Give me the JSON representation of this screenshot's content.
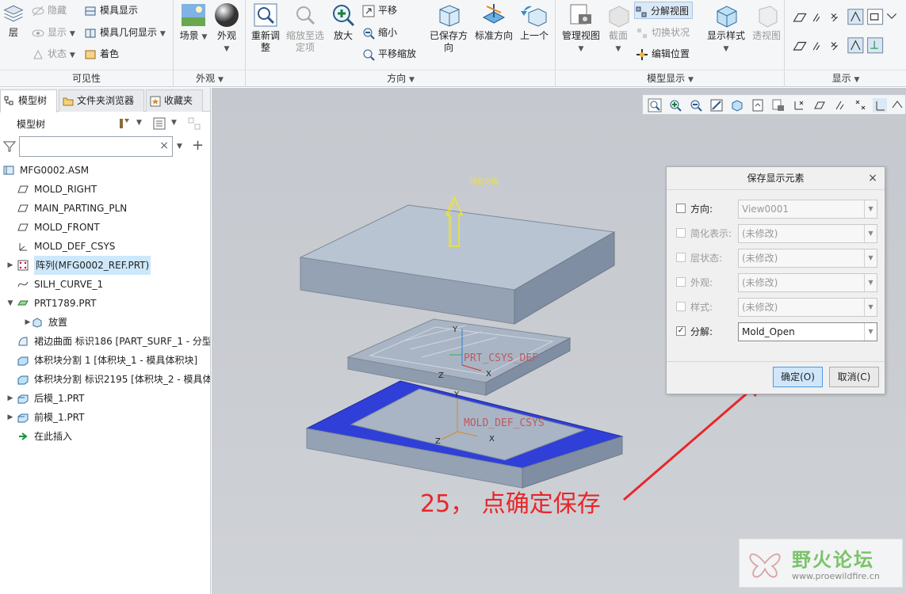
{
  "ribbon": {
    "visibility": {
      "title": "可见性",
      "layer": "层",
      "hide": "隐藏",
      "show": "显示",
      "status": "状态",
      "mold_display": "模具显示",
      "mold_geom_display": "模具几何显示",
      "color": "着色"
    },
    "appearance": {
      "title": "外观",
      "scene": "场景",
      "appearance": "外观"
    },
    "orientation": {
      "title": "方向",
      "refit": "重新调整",
      "zoom_to_selected": "缩放至选定项",
      "zoom_in": "放大",
      "pan": "平移",
      "zoom_out": "缩小",
      "pan_zoom": "平移缩放",
      "saved_orientation": "已保存方向",
      "standard_orientation": "标准方向",
      "previous": "上一个"
    },
    "model_display": {
      "title": "模型显示",
      "manage_views": "管理视图",
      "section": "截面",
      "explode_view": "分解视图",
      "toggle_status": "切换状况",
      "edit_position": "编辑位置"
    },
    "show": {
      "title": "显示",
      "display_style": "显示样式",
      "perspective": "透视图"
    }
  },
  "left_panel": {
    "tabs": [
      "模型树",
      "文件夹浏览器",
      "收藏夹"
    ],
    "tree_header": "模型树",
    "filter_placeholder": "",
    "tree_items": [
      {
        "text": "MFG0002.ASM",
        "level": 0,
        "icon": "assembly-icon",
        "expand": ""
      },
      {
        "text": "MOLD_RIGHT",
        "level": 1,
        "icon": "datum-plane-icon",
        "expand": ""
      },
      {
        "text": "MAIN_PARTING_PLN",
        "level": 1,
        "icon": "datum-plane-icon",
        "expand": ""
      },
      {
        "text": "MOLD_FRONT",
        "level": 1,
        "icon": "datum-plane-icon",
        "expand": ""
      },
      {
        "text": "MOLD_DEF_CSYS",
        "level": 1,
        "icon": "csys-icon",
        "expand": ""
      },
      {
        "text": "阵列(MFG0002_REF.PRT)",
        "level": 1,
        "icon": "pattern-icon",
        "expand": "▶",
        "selected": true
      },
      {
        "text": "SILH_CURVE_1",
        "level": 1,
        "icon": "curve-icon",
        "expand": ""
      },
      {
        "text": "PRT1789.PRT",
        "level": 1,
        "icon": "part-icon",
        "expand": "▼"
      },
      {
        "text": "放置",
        "level": 2,
        "icon": "placement-icon",
        "expand": "▶"
      },
      {
        "text": "裙边曲面 标识186 [PART_SURF_1 - 分型",
        "level": 1,
        "icon": "surface-icon",
        "expand": ""
      },
      {
        "text": "体积块分割 1 [体积块_1 - 模具体积块]",
        "level": 1,
        "icon": "volume-split-icon",
        "expand": ""
      },
      {
        "text": "体积块分割 标识2195 [体积块_2 - 模具体",
        "level": 1,
        "icon": "volume-split-icon",
        "expand": ""
      },
      {
        "text": "后模_1.PRT",
        "level": 1,
        "icon": "mold-part-icon",
        "expand": "▶"
      },
      {
        "text": "前模_1.PRT",
        "level": 1,
        "icon": "mold-part-icon",
        "expand": "▶"
      },
      {
        "text": "在此插入",
        "level": 1,
        "icon": "insert-here-icon",
        "expand": ""
      }
    ]
  },
  "viewport": {
    "pull_direction_label": "拖拉方向",
    "csys_label_1": "PRT_CSYS_DEF",
    "csys_label_2": "MOLD_DEF_CSYS",
    "axis_x": "X",
    "axis_y": "Y",
    "axis_z": "Z"
  },
  "dialog": {
    "title": "保存显示元素",
    "rows": [
      {
        "label": "方向:",
        "value": "View0001",
        "checked": false,
        "enabled": true
      },
      {
        "label": "简化表示:",
        "value": "(未修改)",
        "checked": false,
        "enabled": false
      },
      {
        "label": "层状态:",
        "value": "(未修改)",
        "checked": false,
        "enabled": false
      },
      {
        "label": "外观:",
        "value": "(未修改)",
        "checked": false,
        "enabled": false
      },
      {
        "label": "样式:",
        "value": "(未修改)",
        "checked": false,
        "enabled": false
      },
      {
        "label": "分解:",
        "value": "Mold_Open",
        "checked": true,
        "enabled": true
      }
    ],
    "ok_label": "确定(O)",
    "cancel_label": "取消(C)"
  },
  "annotation": "25， 点确定保存",
  "watermark": {
    "title": "野火论坛",
    "url": "www.proewildfire.cn"
  },
  "colors": {
    "accent_blue": "#2f3fd8",
    "annotation_red": "#e8262a",
    "model_gray": "#9aa7b8",
    "selection": "#cde8fb"
  }
}
